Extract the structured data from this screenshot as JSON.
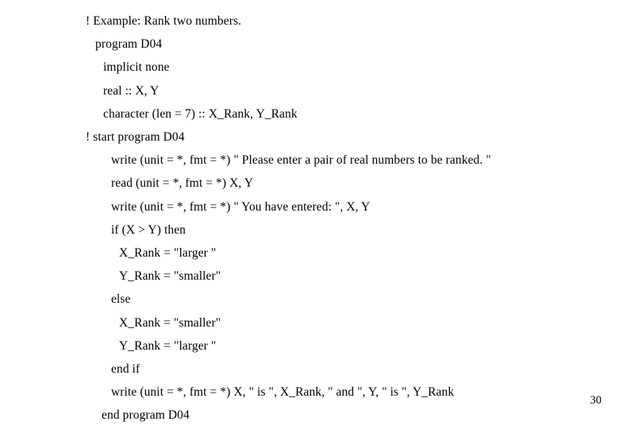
{
  "slide": {
    "page_number": "30",
    "code_lines": [
      {
        "text": "! Example: Rank two numbers.",
        "indent": 0
      },
      {
        "text": "program D04",
        "indent": 1
      },
      {
        "text": "implicit none",
        "indent": 2
      },
      {
        "text": "real :: X, Y",
        "indent": 2
      },
      {
        "text": "character (len = 7) :: X_Rank, Y_Rank",
        "indent": 2
      },
      {
        "text": "! start program D04",
        "indent": 0
      },
      {
        "text": "write (unit = *, fmt = *) \" Please enter a pair of real numbers to be ranked. \"",
        "indent": 3
      },
      {
        "text": "read (unit = *, fmt = *) X, Y",
        "indent": 3
      },
      {
        "text": "write (unit = *, fmt = *) \" You have entered: \", X, Y",
        "indent": 3
      },
      {
        "text": "if (X > Y) then",
        "indent": 3
      },
      {
        "text": "X_Rank = \"larger \"",
        "indent": 5
      },
      {
        "text": "Y_Rank = \"smaller\"",
        "indent": 5
      },
      {
        "text": "else",
        "indent": 3
      },
      {
        "text": "X_Rank = \"smaller\"",
        "indent": 5
      },
      {
        "text": "Y_Rank = \"larger \"",
        "indent": 5
      },
      {
        "text": "end if",
        "indent": 3
      },
      {
        "text": "write (unit = *, fmt = *) X, \" is \", X_Rank, \" and \", Y, \" is \", Y_Rank",
        "indent": 3
      },
      {
        "text": "end program D04",
        "indent": 4
      }
    ]
  }
}
